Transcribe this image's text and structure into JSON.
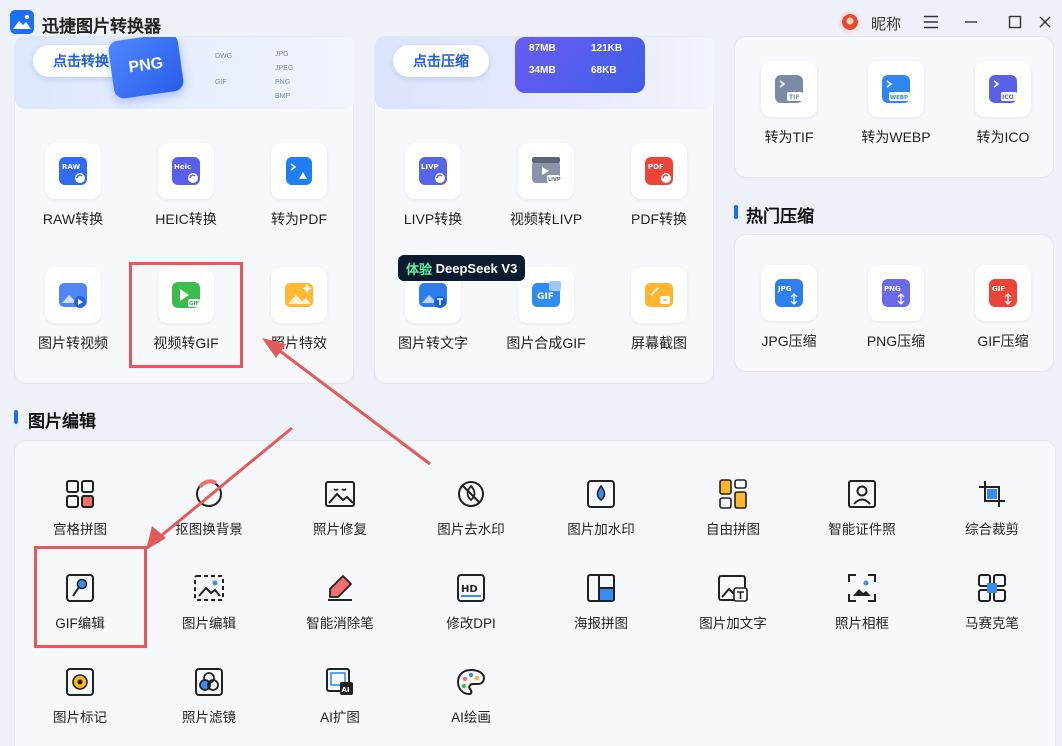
{
  "app": {
    "title": "迅捷图片转换器"
  },
  "user": {
    "name": "昵称"
  },
  "banners": {
    "convert": {
      "button": "点击转换",
      "badge": "PNG",
      "formats": [
        "DWG",
        "JPG",
        "JPEG",
        "GIF",
        "PNG",
        "BMP"
      ]
    },
    "compress": {
      "button": "点击压缩",
      "sizes": [
        "87MB",
        "121KB",
        "34MB",
        "68KB"
      ]
    }
  },
  "convert_tools": [
    {
      "label": "RAW转换",
      "icon": "raw-icon",
      "tag": "RAW"
    },
    {
      "label": "HEIC转换",
      "icon": "heic-icon",
      "tag": "Heic"
    },
    {
      "label": "转为PDF",
      "icon": "pdf-convert-icon",
      "tag": ""
    },
    {
      "label": "图片转视频",
      "icon": "image-to-video-icon",
      "tag": ""
    },
    {
      "label": "视频转GIF",
      "icon": "video-to-gif-icon",
      "tag": "GIF"
    },
    {
      "label": "照片特效",
      "icon": "photo-effects-icon",
      "tag": ""
    }
  ],
  "compress_tools": [
    {
      "label": "LIVP转换",
      "icon": "livp-icon",
      "tag": "LIVP"
    },
    {
      "label": "视频转LIVP",
      "icon": "video-to-livp-icon",
      "tag": "LIVP"
    },
    {
      "label": "PDF转换",
      "icon": "pdf-icon",
      "tag": "PDF"
    },
    {
      "label": "图片转文字",
      "icon": "image-to-text-icon",
      "tag": "T"
    },
    {
      "label": "图片合成GIF",
      "icon": "compose-gif-icon",
      "tag": "GIF"
    },
    {
      "label": "屏幕截图",
      "icon": "screenshot-icon",
      "tag": ""
    }
  ],
  "deepseek_badge": {
    "prefix": "体验",
    "name": "DeepSeek",
    "version": "V3"
  },
  "format_tools": [
    {
      "label": "转为TIF",
      "icon": "tif-icon",
      "tag": "TIF"
    },
    {
      "label": "转为WEBP",
      "icon": "webp-icon",
      "tag": "WEBP"
    },
    {
      "label": "转为ICO",
      "icon": "ico-icon",
      "tag": "ICO"
    }
  ],
  "hot_compress": {
    "title": "热门压缩",
    "items": [
      {
        "label": "JPG压缩",
        "icon": "jpg-compress-icon",
        "tag": "JPG"
      },
      {
        "label": "PNG压缩",
        "icon": "png-compress-icon",
        "tag": "PNG"
      },
      {
        "label": "GIF压缩",
        "icon": "gif-compress-icon",
        "tag": "GIF"
      }
    ]
  },
  "image_edit": {
    "title": "图片编辑",
    "items": [
      {
        "label": "宫格拼图",
        "icon": "grid-collage-icon"
      },
      {
        "label": "抠图换背景",
        "icon": "cutout-background-icon"
      },
      {
        "label": "照片修复",
        "icon": "photo-repair-icon"
      },
      {
        "label": "图片去水印",
        "icon": "remove-watermark-icon"
      },
      {
        "label": "图片加水印",
        "icon": "add-watermark-icon"
      },
      {
        "label": "自由拼图",
        "icon": "free-collage-icon"
      },
      {
        "label": "智能证件照",
        "icon": "id-photo-icon"
      },
      {
        "label": "综合裁剪",
        "icon": "crop-icon"
      },
      {
        "label": "GIF编辑",
        "icon": "gif-edit-icon"
      },
      {
        "label": "图片编辑",
        "icon": "image-edit-icon"
      },
      {
        "label": "智能消除笔",
        "icon": "eraser-pen-icon"
      },
      {
        "label": "修改DPI",
        "icon": "dpi-icon"
      },
      {
        "label": "海报拼图",
        "icon": "poster-collage-icon"
      },
      {
        "label": "图片加文字",
        "icon": "add-text-icon"
      },
      {
        "label": "照片相框",
        "icon": "photo-frame-icon"
      },
      {
        "label": "马赛克笔",
        "icon": "mosaic-icon"
      },
      {
        "label": "图片标记",
        "icon": "image-mark-icon"
      },
      {
        "label": "照片滤镜",
        "icon": "photo-filter-icon"
      },
      {
        "label": "AI扩图",
        "icon": "ai-expand-icon"
      },
      {
        "label": "AI绘画",
        "icon": "ai-paint-icon"
      }
    ]
  },
  "colors": {
    "accent": "#1d6ff2",
    "highlight": "#e25a5a",
    "panel": "#f6f8fc",
    "background": "#eef2f8"
  }
}
